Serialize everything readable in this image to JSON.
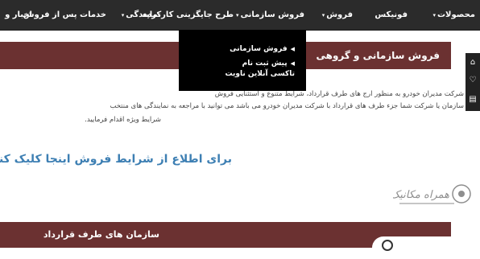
{
  "nav": {
    "items": [
      {
        "label": "محصولات",
        "caret": "▾"
      },
      {
        "label": "فونیکس",
        "caret": ""
      },
      {
        "label": "فروش",
        "caret": "▾"
      },
      {
        "label": "فروش سازمانی",
        "caret": "▾"
      },
      {
        "label": "طرح جایگزینی کارکرده",
        "caret": ""
      },
      {
        "label": "نمایندگی",
        "caret": "▾"
      },
      {
        "label": "خدمات پس از فروش",
        "caret": ""
      },
      {
        "label": "اخبار و",
        "caret": ""
      }
    ]
  },
  "dropdown": {
    "items": [
      {
        "label": "فروش سازمانی"
      },
      {
        "label": "پیش ثبت نام تاکسی آنلاین ناویت"
      }
    ]
  },
  "section": {
    "title": "فروش سازمانی و گروهی"
  },
  "content": {
    "line1": "شرکت مدیران خودرو به منظور ارج  های طرف قرارداد، شرایط متنوع و استثنایی فروش",
    "line2": "سازمان یا شرکت شما جزء طرف های قرارداد با شرکت مدیران خودرو می باشد می توانید با مراجعه به نمایندگی های منتخب",
    "line3": "شرایط ویژه اقدام فرمایید.",
    "cta": "برای اطلاع از شرایط فروش اینجا کلیک کنید"
  },
  "bottom": {
    "title": "سازمان های طرف قرارداد"
  },
  "watermark": {
    "text": "همراه مکانیک"
  },
  "colors": {
    "nav_bg": "#2b2b2b",
    "section_bg": "#6b3131",
    "link": "#3d7fb3"
  }
}
